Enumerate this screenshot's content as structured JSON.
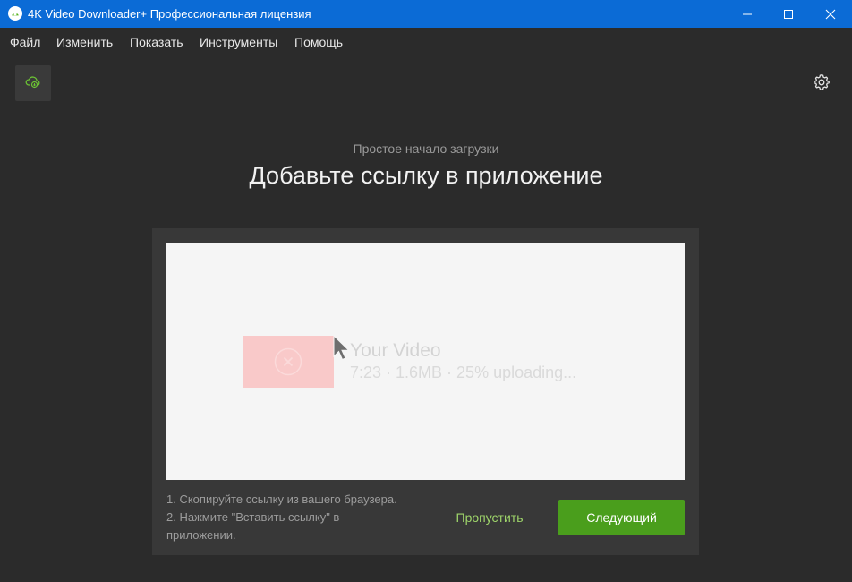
{
  "window": {
    "title": "4K Video Downloader+ Профессиональная лицензия"
  },
  "menu": {
    "items": [
      "Файл",
      "Изменить",
      "Показать",
      "Инструменты",
      "Помощь"
    ]
  },
  "toolbar": {
    "smart_mode_icon": "cloud-download-icon",
    "settings_icon": "gear-icon"
  },
  "onboarding": {
    "subtitle": "Простое начало загрузки",
    "heading": "Добавьте ссылку в приложение",
    "demo": {
      "video_title": "Your Video",
      "video_meta": "7:23 · 1.6MB · 25% uploading..."
    },
    "steps": [
      "1. Скопируйте ссылку из вашего браузера.",
      "2. Нажмите \"Вставить ссылку\" в приложении."
    ],
    "skip_label": "Пропустить",
    "next_label": "Следующий"
  },
  "colors": {
    "titlebar": "#0b6bd6",
    "background": "#2b2b2b",
    "accent_green": "#4a9e1c",
    "link_green": "#9ed46a"
  }
}
